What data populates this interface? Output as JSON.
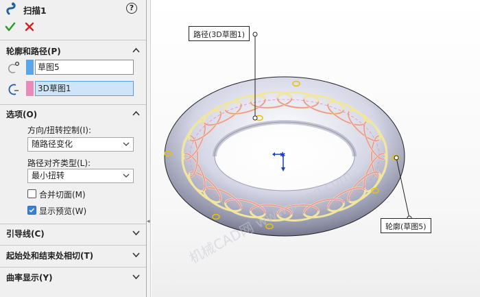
{
  "feature": {
    "title": "扫描1",
    "help": "?"
  },
  "groups": {
    "profile_path": {
      "label": "轮廓和路径(P)",
      "profile_value": "草图5",
      "path_value": "3D草图1"
    },
    "options": {
      "label": "选项(O)",
      "orientation_label": "方向/扭转控制(I):",
      "orientation_value": "随路径变化",
      "alignment_label": "路径对齐类型(L):",
      "alignment_value": "最小扭转",
      "merge_faces": {
        "label": "合并切面(M)",
        "checked": false
      },
      "show_preview": {
        "label": "显示预览(W)",
        "checked": true
      }
    },
    "guide_curves": {
      "label": "引导线(C)"
    },
    "tangency": {
      "label": "起始处和结束处相切(T)"
    },
    "curvature": {
      "label": "曲率显示(Y)"
    }
  },
  "viewport": {
    "path_callout": "路径(3D草图1)",
    "profile_callout": "轮廓(草图5)",
    "watermark": "机械CAD网 www.jxcad.com"
  },
  "colors": {
    "profile_swatch": "#5aa6ea",
    "path_swatch": "#e88bb6",
    "ok_green": "#2e9b2e",
    "cancel_red": "#d42020",
    "coil_pink": "#e98fb0",
    "coil_yellow": "#f0e6a0"
  }
}
